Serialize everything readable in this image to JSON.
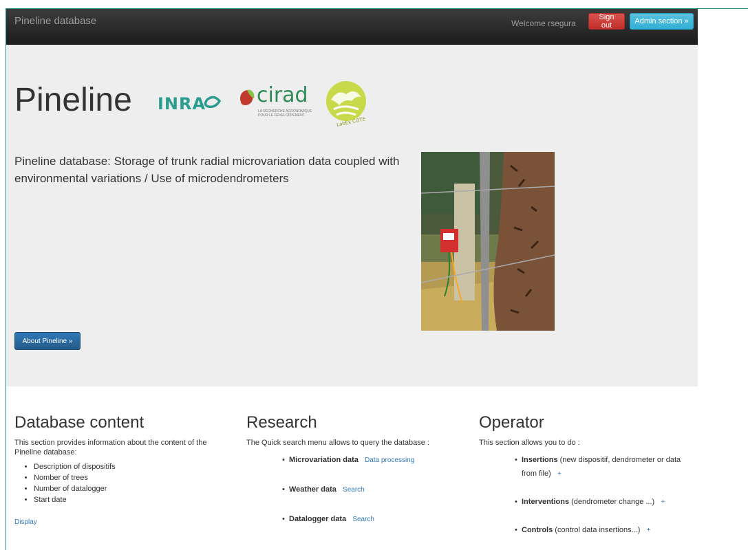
{
  "navbar": {
    "brand": "Pineline database",
    "welcome": "Welcome rsegura",
    "sign_out": "Sign out",
    "admin": "Admin section »"
  },
  "hero": {
    "title": "Pineline",
    "logos": {
      "inrae": "INRAE",
      "cirad": "cirad",
      "cirad_tagline": "LA RECHERCHE AGRONOMIQUE POUR LE DÉVELOPPEMENT",
      "labex": "LabEx COTE"
    },
    "description": "Pineline database: Storage of trunk radial microvariation data coupled with environmental variations / Use of microdendrometers",
    "about_button": "About Pineline »"
  },
  "sections": {
    "database": {
      "title": "Database content",
      "intro": "This section provides information about the content of the Pineline database:",
      "items": [
        "Description of dispositifs",
        "Nomber of trees",
        "Number of datalogger",
        "Start date"
      ],
      "link": "Display"
    },
    "research": {
      "title": "Research",
      "intro": "The Quick search menu allows to query the database :",
      "items": [
        {
          "label": "Microvariation data",
          "link": "Data processing"
        },
        {
          "label": "Weather data",
          "link": "Search"
        },
        {
          "label": "Datalogger data",
          "link": "Search"
        }
      ]
    },
    "operator": {
      "title": "Operator",
      "intro": "This section allows you to do :",
      "items": [
        {
          "label": "Insertions",
          "detail": " (new dispositif, dendrometer or data from file)",
          "link": "+"
        },
        {
          "label": "Interventions",
          "detail": " (dendrometer change ...)",
          "link": "+"
        },
        {
          "label": "Controls",
          "detail": " (control data insertions...)",
          "link": "+"
        }
      ]
    }
  },
  "colors": {
    "navbar": "#222222",
    "danger": "#d9534f",
    "info": "#5bc0de",
    "primary": "#2a6496",
    "link": "#337ab7",
    "jumbotron": "#eeeeee"
  }
}
